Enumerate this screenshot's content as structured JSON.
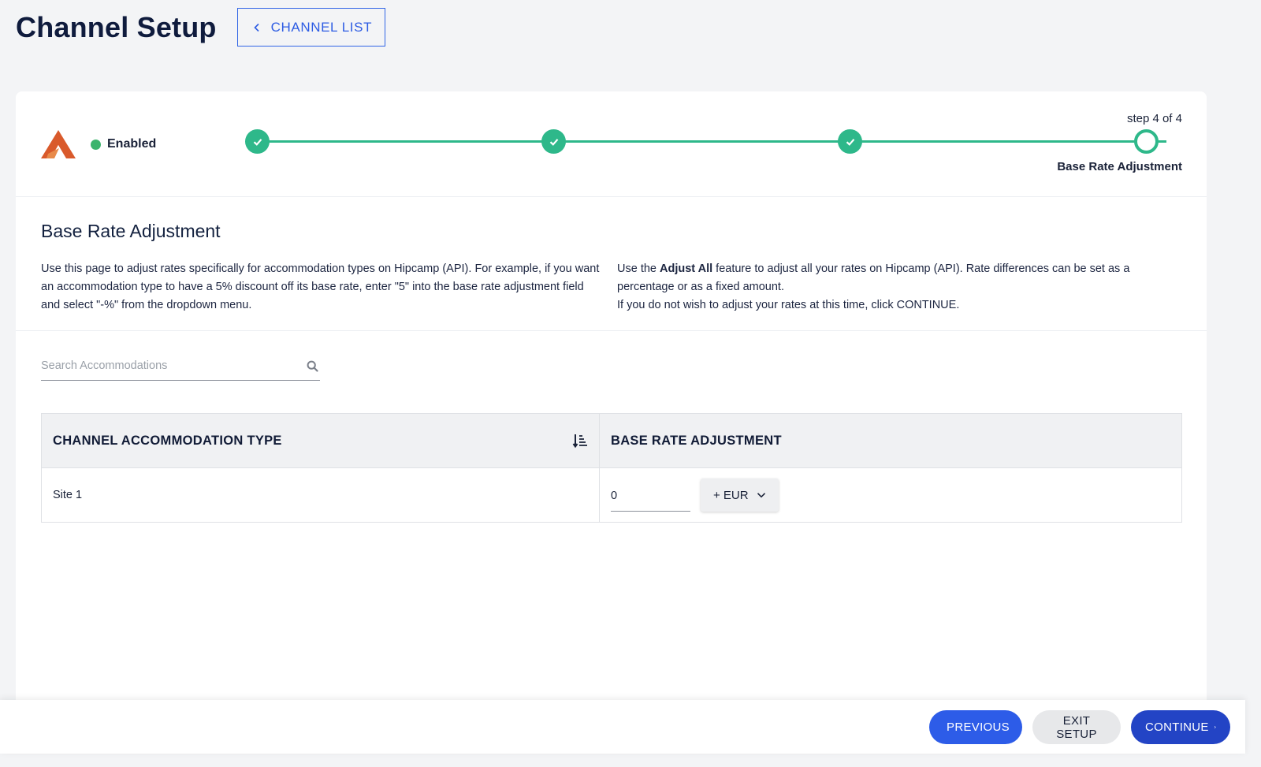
{
  "header": {
    "title": "Channel Setup",
    "back_button_label": "CHANNEL LIST"
  },
  "stepper": {
    "status_label": "Enabled",
    "status_color": "#3cb46c",
    "step_count_label": "step 4 of 4",
    "current_step_label": "Base Rate Adjustment",
    "accent_color": "#2eb88a",
    "steps": [
      {
        "state": "complete"
      },
      {
        "state": "complete"
      },
      {
        "state": "complete"
      },
      {
        "state": "current"
      }
    ]
  },
  "intro": {
    "title": "Base Rate Adjustment",
    "left_text": "Use this page to adjust rates specifically for accommodation types on Hipcamp (API). For example, if you want an accommodation type to have a 5% discount off its base rate, enter \"5\" into the base rate adjustment field and select \"-%\" from the dropdown menu.",
    "right_prefix": "Use the ",
    "right_bold": "Adjust All",
    "right_suffix": " feature to adjust all your rates on Hipcamp (API). Rate differences can be set as a percentage or as a fixed amount.",
    "right_line2": "If you do not wish to adjust your rates at this time, click CONTINUE."
  },
  "search": {
    "placeholder": "Search Accommodations",
    "value": ""
  },
  "table": {
    "col_type": "CHANNEL ACCOMMODATION TYPE",
    "col_adjustment": "BASE RATE ADJUSTMENT",
    "rows": [
      {
        "name": "Site 1",
        "value": "0",
        "unit": "+ EUR"
      }
    ]
  },
  "footer": {
    "previous_label": "PREVIOUS",
    "exit_label": "EXIT SETUP",
    "continue_label": "CONTINUE"
  },
  "icons": {
    "logo": "hipcamp-logo-icon",
    "back": "chevron-left-icon",
    "search": "search-icon",
    "sort": "sort-descending-icon",
    "dropdown": "chevron-down-icon",
    "check": "check-icon"
  },
  "colors": {
    "primary": "#2d5ce8",
    "primary_dark": "#2344c5",
    "logo": "#d95a2b"
  }
}
